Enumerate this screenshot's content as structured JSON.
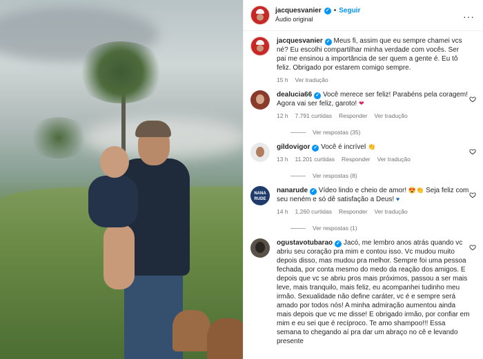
{
  "post": {
    "username": "jacquesvanier",
    "follow_label": "Seguir",
    "audio_label": "Áudio original",
    "more_label": "···"
  },
  "caption": {
    "username": "jacquesvanier",
    "text": "Meus fi, assim que eu sempre chamei vcs né? Eu escolhi compartilhar minha verdade com vocês. Ser pai me ensinou a importância de ser quem a gente é. Eu tô feliz. Obrigado por estarem comigo sempre.",
    "time": "15 h",
    "translate_label": "Ver tradução"
  },
  "comments": [
    {
      "username": "dealucia66",
      "text": "Você merece ser feliz! Parabéns pela coragem! Agora vai ser feliz, garoto!",
      "emoji": "❤️",
      "time": "12 h",
      "likes": "7.791 curtidas",
      "reply_label": "Responder",
      "translate_label": "Ver tradução",
      "replies_label": "Ver respostas (35)"
    },
    {
      "username": "gildovigor",
      "text": "Você é incrível",
      "emoji": "👏",
      "time": "13 h",
      "likes": "11.201 curtidas",
      "reply_label": "Responder",
      "translate_label": "Ver tradução",
      "replies_label": "Ver respostas (8)"
    },
    {
      "username": "nanarude",
      "avatar_text": "NANA RUDE",
      "text_a": "Vídeo lindo e cheio de amor!",
      "emoji_a": "😍👏",
      "text_b": "Seja feliz com seu neném e só dê satisfação a Deus!",
      "emoji_b": "💙",
      "time": "14 h",
      "likes": "1.260 curtidas",
      "reply_label": "Responder",
      "translate_label": "Ver tradução",
      "replies_label": "Ver respostas (1)"
    },
    {
      "username": "ogustavotubarao",
      "text": "Jacó, me lembro anos atrás quando vc abriu seu coração pra mim e contou isso. Vc mudou muito depois disso, mas mudou pra melhor. Sempre foi uma pessoa fechada, por conta mesmo do medo da reação dos amigos. E depois que vc se abriu pros mais próximos, passou a ser mais leve, mais tranquilo, mais feliz, eu acompanhei tudinho meu irmão. Sexualidade não define caráter, vc é e sempre será amado por todos nós! A minha admiração aumentou ainda mais depois que vc me disse! E obrigado irmão, por confiar em mim e eu sei que é recíproco. Te amo shampoo!!! Essa semana to chegando aí pra dar um abraço no cê e levando presente"
    }
  ],
  "colors": {
    "accent": "#0095f6",
    "muted": "#737373",
    "text": "#262626"
  }
}
